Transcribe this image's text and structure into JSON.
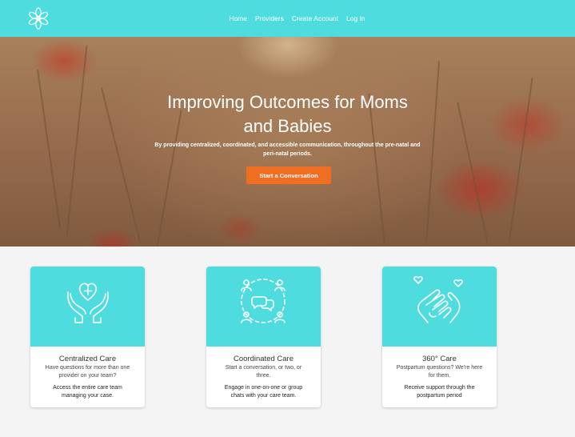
{
  "nav": {
    "items": [
      "Home",
      "Providers",
      "Create Account",
      "Log In"
    ]
  },
  "logo": {
    "icon": "flower-icon"
  },
  "colors": {
    "topbar": "#4fdcdf",
    "cta": "#ef6e22",
    "card_band": "#4fdcdf"
  },
  "hero": {
    "title_line1": "Improving Outcomes for Moms",
    "title_line2": "and Babies",
    "subtitle_line1": "By providing centralized, coordinated, and accessible communication, throughout the pre-natal and",
    "subtitle_line2": "peri-natal periods.",
    "cta_label": "Start a Conversation"
  },
  "cards": [
    {
      "icon": "heart-hands-icon",
      "title": "Centralized Care",
      "text1_l1": "Have questions for more than one",
      "text1_l2": "provider on your team?",
      "text2_l1": "Access the entire care team",
      "text2_l2": "managing your case."
    },
    {
      "icon": "group-chat-icon",
      "title": "Coordinated Care",
      "text1_l1": "Start a conversation, or two, or",
      "text1_l2": "three.",
      "text2_l1": "Engage in one-on-one or group",
      "text2_l2": "chats with your care team."
    },
    {
      "icon": "holding-hands-icon",
      "title": "360° Care",
      "text1_l1": "Postpartum questions? We're here",
      "text1_l2": "for them.",
      "text2_l1": "Receive support through the",
      "text2_l2": "postpartum period"
    }
  ]
}
